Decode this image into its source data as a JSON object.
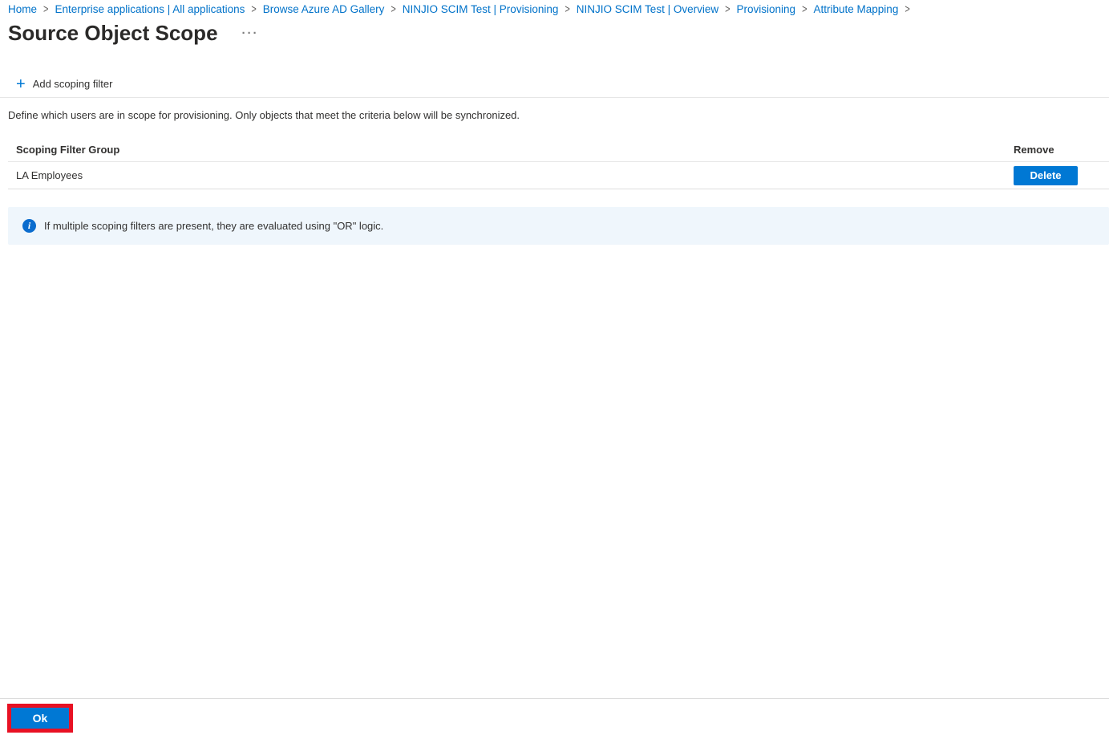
{
  "breadcrumb": {
    "separator": ">",
    "items": [
      "Home",
      "Enterprise applications | All applications",
      "Browse Azure AD Gallery",
      "NINJIO SCIM Test | Provisioning",
      "NINJIO SCIM Test | Overview",
      "Provisioning",
      "Attribute Mapping"
    ]
  },
  "page": {
    "title": "Source Object Scope",
    "more_glyph": "···",
    "description": "Define which users are in scope for provisioning. Only objects that meet the criteria below will be synchronized."
  },
  "toolbar": {
    "plus_glyph": "+",
    "add_filter_label": "Add scoping filter"
  },
  "table": {
    "columns": [
      "Scoping Filter Group",
      "Remove"
    ],
    "rows": [
      {
        "name": "LA Employees",
        "action_label": "Delete"
      }
    ]
  },
  "banner": {
    "icon_glyph": "i",
    "text": "If multiple scoping filters are present, they are evaluated using \"OR\" logic."
  },
  "footer": {
    "ok_label": "Ok"
  },
  "colors": {
    "accent": "#0078d4",
    "link": "#0072c9",
    "annotation_red": "#e81123",
    "banner_bg": "#eff6fc"
  }
}
